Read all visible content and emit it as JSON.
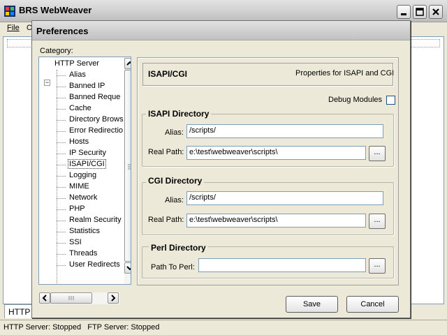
{
  "window": {
    "title": "BRS WebWeaver",
    "min_icon": "minimize-icon",
    "max_icon": "maximize-icon",
    "close_icon": "close-icon"
  },
  "menu": {
    "file": "File",
    "second_partial": "O"
  },
  "main_tab_stub": "HTTP",
  "statusbar": {
    "text": "HTTP Server: Stopped   FTP Server: Stopped"
  },
  "dialog": {
    "title": "Preferences",
    "category_label": "Category:",
    "tree": {
      "root": "HTTP Server",
      "root_expander": "−",
      "items": [
        {
          "label": "Alias",
          "selected": false
        },
        {
          "label": "Banned IP",
          "selected": false
        },
        {
          "label": "Banned Reque",
          "selected": false
        },
        {
          "label": "Cache",
          "selected": false
        },
        {
          "label": "Directory Brows",
          "selected": false
        },
        {
          "label": "Error Redirectio",
          "selected": false
        },
        {
          "label": "Hosts",
          "selected": false
        },
        {
          "label": "IP Security",
          "selected": false
        },
        {
          "label": "ISAPI/CGI",
          "selected": true
        },
        {
          "label": "Logging",
          "selected": false
        },
        {
          "label": "MIME",
          "selected": false
        },
        {
          "label": "Network",
          "selected": false
        },
        {
          "label": "PHP",
          "selected": false
        },
        {
          "label": "Realm Security",
          "selected": false
        },
        {
          "label": "Statistics",
          "selected": false
        },
        {
          "label": "SSI",
          "selected": false
        },
        {
          "label": "Threads",
          "selected": false
        },
        {
          "label": "User Redirects",
          "selected": false
        }
      ]
    },
    "panel": {
      "header_title": "ISAPI/CGI",
      "header_desc": "Properties for ISAPI and CGI",
      "debug_label": "Debug Modules",
      "debug_checked": false,
      "isapi": {
        "title": "ISAPI Directory",
        "alias_label": "Alias:",
        "alias_value": "/scripts/",
        "path_label": "Real Path:",
        "path_value": "e:\\test\\webweaver\\scripts\\",
        "browse": "..."
      },
      "cgi": {
        "title": "CGI Directory",
        "alias_label": "Alias:",
        "alias_value": "/scripts/",
        "path_label": "Real Path:",
        "path_value": "e:\\test\\webweaver\\scripts\\",
        "browse": "..."
      },
      "perl": {
        "title": "Perl Directory",
        "path_label": "Path To Perl:",
        "path_value": "",
        "browse": "..."
      }
    },
    "buttons": {
      "save": "Save",
      "cancel": "Cancel"
    }
  },
  "colors": {
    "window_bg": "#ece9d8",
    "field_border": "#7f9db9",
    "selection_dotted": "#333333"
  }
}
